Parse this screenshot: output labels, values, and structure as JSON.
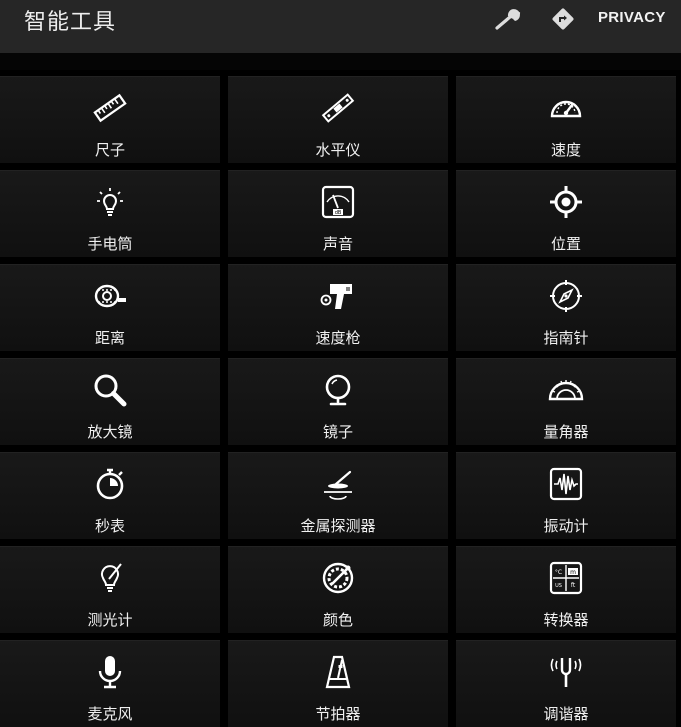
{
  "appbar": {
    "title": "智能工具",
    "privacy_label": "PRIVACY"
  },
  "tools": [
    {
      "label": "尺子"
    },
    {
      "label": "水平仪"
    },
    {
      "label": "速度"
    },
    {
      "label": "手电筒"
    },
    {
      "label": "声音"
    },
    {
      "label": "位置"
    },
    {
      "label": "距离"
    },
    {
      "label": "速度枪"
    },
    {
      "label": "指南针"
    },
    {
      "label": "放大镜"
    },
    {
      "label": "镜子"
    },
    {
      "label": "量角器"
    },
    {
      "label": "秒表"
    },
    {
      "label": "金属探测器"
    },
    {
      "label": "振动计"
    },
    {
      "label": "测光计"
    },
    {
      "label": "颜色"
    },
    {
      "label": "转换器"
    },
    {
      "label": "麦克风"
    },
    {
      "label": "节拍器"
    },
    {
      "label": "调谐器"
    }
  ]
}
